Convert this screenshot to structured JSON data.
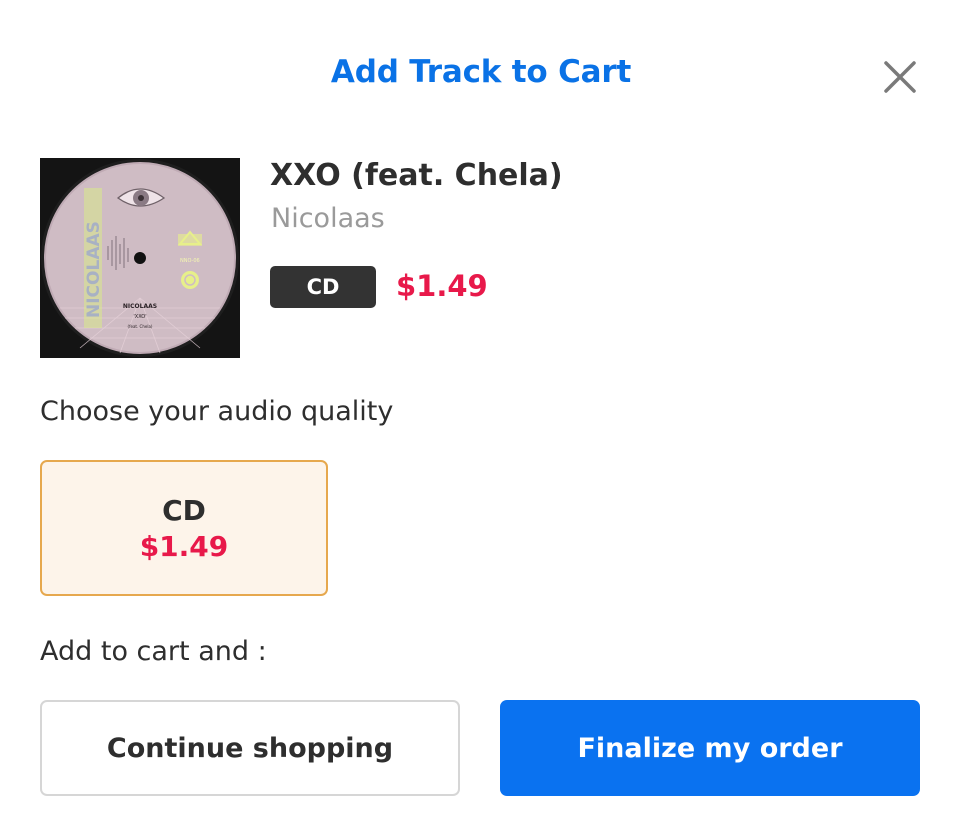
{
  "modal": {
    "title": "Add Track to Cart",
    "close_icon": "close-icon"
  },
  "track": {
    "title": "XXO (feat. Chela)",
    "artist": "Nicolaas",
    "format_badge": "CD",
    "price": "$1.49",
    "cover_text": {
      "artist": "NICOLAAS",
      "title": "'XXO'",
      "feat": "(feat. Chela)",
      "side_text": "NICOLAAS",
      "catalog": "NNO-06"
    }
  },
  "quality": {
    "label": "Choose your audio quality",
    "options": [
      {
        "name": "CD",
        "price": "$1.49",
        "selected": true
      }
    ]
  },
  "actions": {
    "label": "Add to cart and :",
    "continue_label": "Continue shopping",
    "finalize_label": "Finalize my order"
  },
  "colors": {
    "accent": "#0a72e6",
    "price": "#e8194a",
    "selected_border": "#e6a84e",
    "selected_bg": "#fdf4ea",
    "badge_bg": "#333333"
  }
}
